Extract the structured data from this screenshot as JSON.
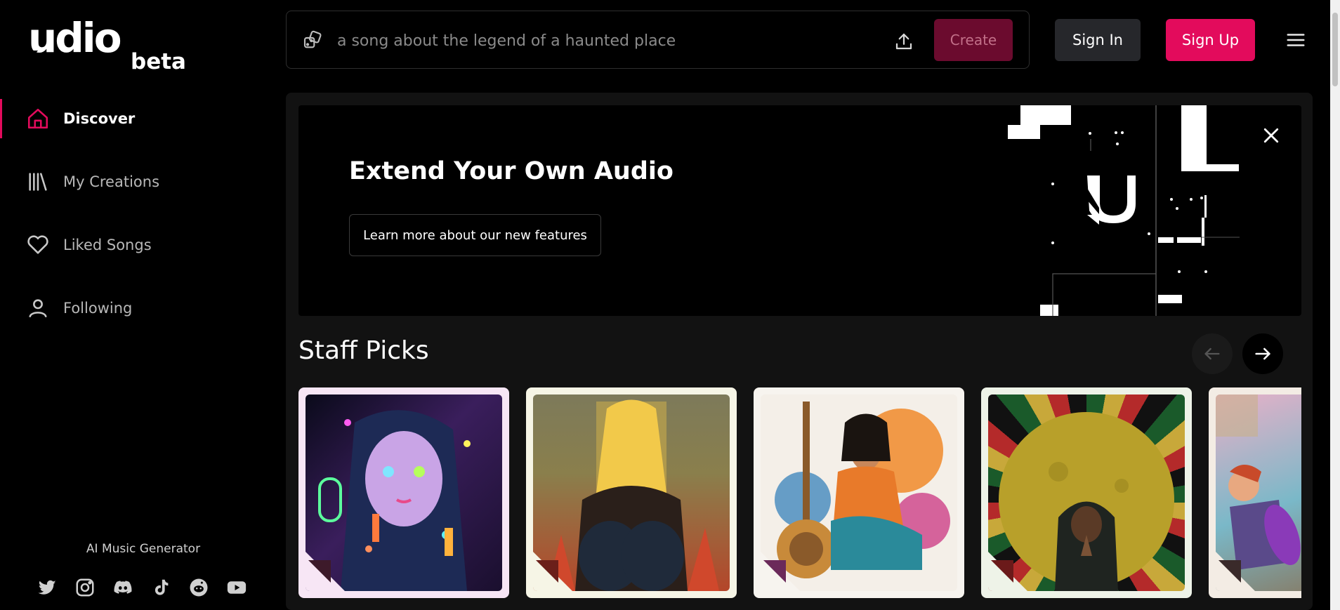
{
  "brand": {
    "name": "udio",
    "tag": "beta",
    "accent": "#e30b5c"
  },
  "sidebar": {
    "items": [
      {
        "label": "Discover",
        "icon": "home-icon",
        "active": true
      },
      {
        "label": "My Creations",
        "icon": "library-icon",
        "active": false
      },
      {
        "label": "Liked Songs",
        "icon": "heart-icon",
        "active": false
      },
      {
        "label": "Following",
        "icon": "user-icon",
        "active": false
      }
    ],
    "footer_text": "AI Music Generator",
    "socials": [
      "twitter-icon",
      "instagram-icon",
      "discord-icon",
      "tiktok-icon",
      "reddit-icon",
      "youtube-icon"
    ]
  },
  "topbar": {
    "prompt_placeholder": "a song about the legend of a haunted place",
    "create_label": "Create",
    "signin_label": "Sign In",
    "signup_label": "Sign Up"
  },
  "banner": {
    "title": "Extend Your Own Audio",
    "button_label": "Learn more about our new features"
  },
  "staff_picks": {
    "title": "Staff Picks",
    "cards": [
      {
        "theme": "neon anime girl",
        "frame": "#f7e6f5"
      },
      {
        "theme": "blonde figure silhouette",
        "frame": "#f6f5e6"
      },
      {
        "theme": "woman with sitar",
        "frame": "#f7f4ef"
      },
      {
        "theme": "hooded man before moon",
        "frame": "#eef3e8"
      },
      {
        "theme": "skateboarder",
        "frame": "#f3ece4"
      }
    ]
  }
}
